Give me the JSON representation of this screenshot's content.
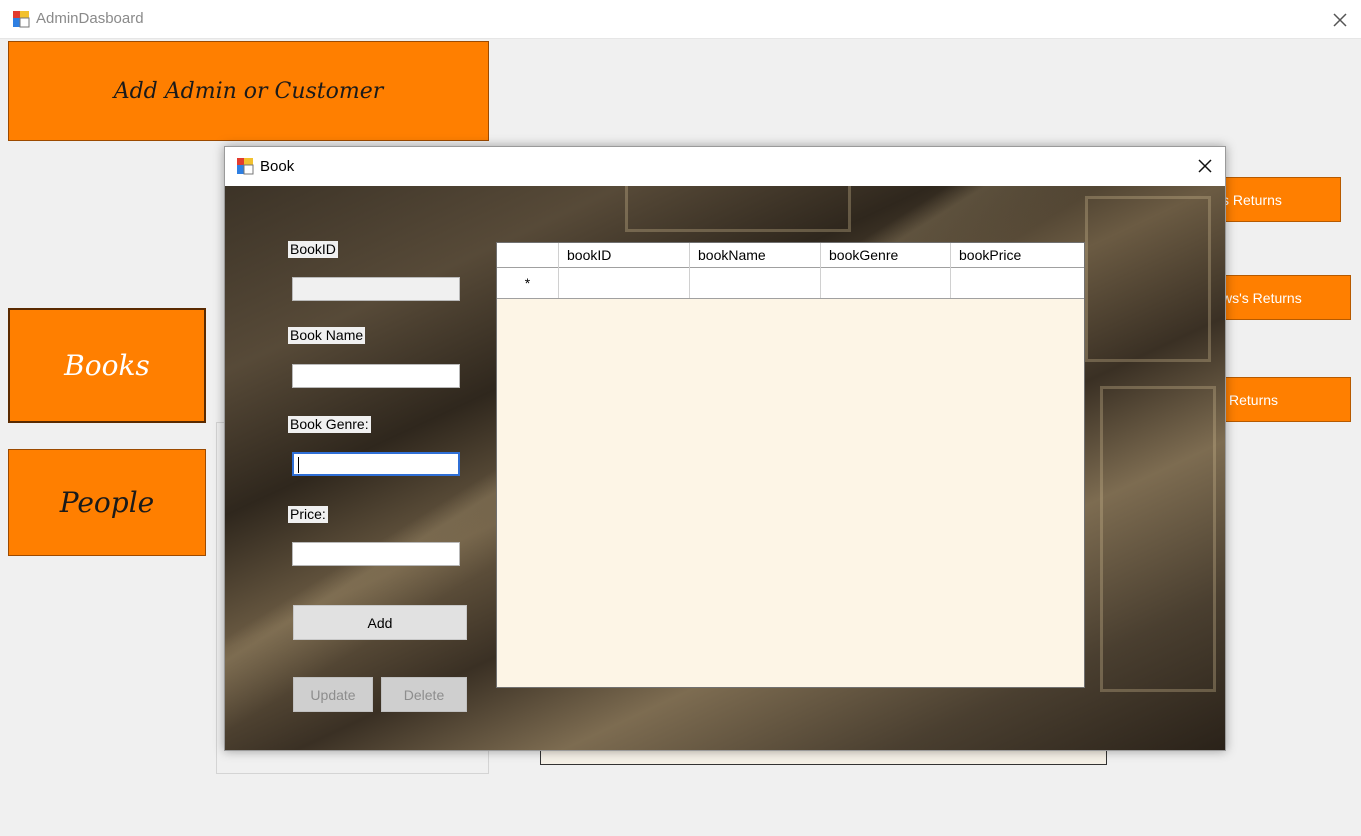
{
  "main_window": {
    "title": "AdminDasboard",
    "add_button": "Add Admin or Customer",
    "books_button": "Books",
    "people_button": "People",
    "returns_buttons": [
      "s Returns",
      "ws's Returns",
      "Returns"
    ]
  },
  "book_dialog": {
    "title": "Book",
    "book_id_label": "BookID",
    "book_name_label": "Book Name",
    "book_genre_label": "Book Genre:",
    "price_label": "Price:",
    "add_button": "Add",
    "update_button": "Update",
    "delete_button": "Delete",
    "grid": {
      "columns": [
        "",
        "bookID",
        "bookName",
        "bookGenre",
        "bookPrice"
      ],
      "new_row_marker": "*"
    }
  },
  "colors": {
    "accent_orange": "#ff7f00",
    "grid_background": "#fdf5e6",
    "focus_border": "#2f6fd6"
  },
  "icons": [
    "app-icon",
    "close-icon"
  ]
}
